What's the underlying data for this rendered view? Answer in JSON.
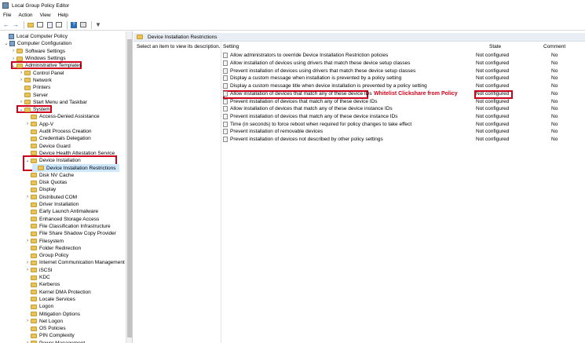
{
  "window": {
    "title": "Local Group Policy Editor"
  },
  "menu": {
    "file": "File",
    "action": "Action",
    "view": "View",
    "help": "Help"
  },
  "toolbar_icons": [
    "back-arrow-icon",
    "forward-arrow-icon",
    "up-folder-icon",
    "show-hide-tree-icon",
    "export-list-icon",
    "properties-icon",
    "help-icon",
    "view-icon",
    "filter-icon"
  ],
  "tree": {
    "items": [
      {
        "label": "Local Computer Policy",
        "level": 0,
        "expander": "",
        "icon": "root"
      },
      {
        "label": "Computer Configuration",
        "level": 1,
        "expander": "⌄",
        "icon": "root"
      },
      {
        "label": "Software Settings",
        "level": 2,
        "expander": "›",
        "icon": "folder"
      },
      {
        "label": "Windows Settings",
        "level": 2,
        "expander": "›",
        "icon": "folder"
      },
      {
        "label": "Administrative Templates",
        "level": 2,
        "expander": "⌄",
        "icon": "folder"
      },
      {
        "label": "Control Panel",
        "level": 3,
        "expander": "›",
        "icon": "folder"
      },
      {
        "label": "Network",
        "level": 3,
        "expander": "›",
        "icon": "folder"
      },
      {
        "label": "Printers",
        "level": 3,
        "expander": "",
        "icon": "folder"
      },
      {
        "label": "Server",
        "level": 3,
        "expander": "",
        "icon": "folder"
      },
      {
        "label": "Start Menu and Taskbar",
        "level": 3,
        "expander": "›",
        "icon": "folder"
      },
      {
        "label": "System",
        "level": 3,
        "expander": "⌄",
        "icon": "folder"
      },
      {
        "label": "Access-Denied Assistance",
        "level": 4,
        "expander": "",
        "icon": "folder"
      },
      {
        "label": "App-V",
        "level": 4,
        "expander": "›",
        "icon": "folder"
      },
      {
        "label": "Audit Process Creation",
        "level": 4,
        "expander": "",
        "icon": "folder"
      },
      {
        "label": "Credentials Delegation",
        "level": 4,
        "expander": "",
        "icon": "folder"
      },
      {
        "label": "Device Guard",
        "level": 4,
        "expander": "",
        "icon": "folder"
      },
      {
        "label": "Device Health Attestation Service",
        "level": 4,
        "expander": "",
        "icon": "folder"
      },
      {
        "label": "Device Installation",
        "level": 4,
        "expander": "⌄",
        "icon": "folder"
      },
      {
        "label": "Device Installation Restrictions",
        "level": 5,
        "expander": "",
        "icon": "folder",
        "selected": true
      },
      {
        "label": "Disk NV Cache",
        "level": 4,
        "expander": "",
        "icon": "folder"
      },
      {
        "label": "Disk Quotas",
        "level": 4,
        "expander": "",
        "icon": "folder"
      },
      {
        "label": "Display",
        "level": 4,
        "expander": "",
        "icon": "folder"
      },
      {
        "label": "Distributed COM",
        "level": 4,
        "expander": "›",
        "icon": "folder"
      },
      {
        "label": "Driver Installation",
        "level": 4,
        "expander": "",
        "icon": "folder"
      },
      {
        "label": "Early Launch Antimalware",
        "level": 4,
        "expander": "",
        "icon": "folder"
      },
      {
        "label": "Enhanced Storage Access",
        "level": 4,
        "expander": "",
        "icon": "folder"
      },
      {
        "label": "File Classification Infrastructure",
        "level": 4,
        "expander": "",
        "icon": "folder"
      },
      {
        "label": "File Share Shadow Copy Provider",
        "level": 4,
        "expander": "",
        "icon": "folder"
      },
      {
        "label": "Filesystem",
        "level": 4,
        "expander": "›",
        "icon": "folder"
      },
      {
        "label": "Folder Redirection",
        "level": 4,
        "expander": "",
        "icon": "folder"
      },
      {
        "label": "Group Policy",
        "level": 4,
        "expander": "",
        "icon": "folder"
      },
      {
        "label": "Internet Communication Management",
        "level": 4,
        "expander": "›",
        "icon": "folder"
      },
      {
        "label": "iSCSI",
        "level": 4,
        "expander": "›",
        "icon": "folder"
      },
      {
        "label": "KDC",
        "level": 4,
        "expander": "",
        "icon": "folder"
      },
      {
        "label": "Kerberos",
        "level": 4,
        "expander": "",
        "icon": "folder"
      },
      {
        "label": "Kernel DMA Protection",
        "level": 4,
        "expander": "",
        "icon": "folder"
      },
      {
        "label": "Locale Services",
        "level": 4,
        "expander": "",
        "icon": "folder"
      },
      {
        "label": "Logon",
        "level": 4,
        "expander": "",
        "icon": "folder"
      },
      {
        "label": "Mitigation Options",
        "level": 4,
        "expander": "",
        "icon": "folder"
      },
      {
        "label": "Net Logon",
        "level": 4,
        "expander": "›",
        "icon": "folder"
      },
      {
        "label": "OS Policies",
        "level": 4,
        "expander": "",
        "icon": "folder"
      },
      {
        "label": "PIN Complexity",
        "level": 4,
        "expander": "",
        "icon": "folder"
      },
      {
        "label": "Power Management",
        "level": 4,
        "expander": "›",
        "icon": "folder"
      }
    ]
  },
  "right": {
    "header": "Device Installation Restrictions",
    "description": "Select an item to view its description.",
    "columns": {
      "setting": "Setting",
      "state": "State",
      "comment": "Comment"
    },
    "policies": [
      {
        "name": "Allow administrators to override Device Installation Restriction policies",
        "state": "Not configured",
        "comment": "No"
      },
      {
        "name": "Allow installation of devices using drivers that match these device setup classes",
        "state": "Not configured",
        "comment": "No"
      },
      {
        "name": "Prevent installation of devices using drivers that match these device setup classes",
        "state": "Not configured",
        "comment": "No"
      },
      {
        "name": "Display a custom message when installation is prevented by a policy setting",
        "state": "Not configured",
        "comment": "No"
      },
      {
        "name": "Display a custom message title when device installation is prevented by a policy setting",
        "state": "Not configured",
        "comment": "No"
      },
      {
        "name": "Allow installation of devices that match any of these device IDs",
        "state": "Not configured",
        "comment": "No",
        "highlight": true
      },
      {
        "name": "Prevent installation of devices that match any of these device IDs",
        "state": "Not configured",
        "comment": "No"
      },
      {
        "name": "Allow installation of devices that match any of these device instance IDs",
        "state": "Not configured",
        "comment": "No"
      },
      {
        "name": "Prevent installation of devices that match any of these device instance IDs",
        "state": "Not configured",
        "comment": "No"
      },
      {
        "name": "Time (in seconds) to force reboot when required for policy changes to take effect",
        "state": "Not configured",
        "comment": "No"
      },
      {
        "name": "Prevent installation of removable devices",
        "state": "Not configured",
        "comment": "No"
      },
      {
        "name": "Prevent installation of devices not described by other policy settings",
        "state": "Not configured",
        "comment": "No"
      }
    ],
    "annotation": "Whitelist Clickshare from Policy"
  },
  "colors": {
    "highlight_red": "#d0021b",
    "selection": "#cde8ff",
    "header_bg": "#e9eef5"
  }
}
